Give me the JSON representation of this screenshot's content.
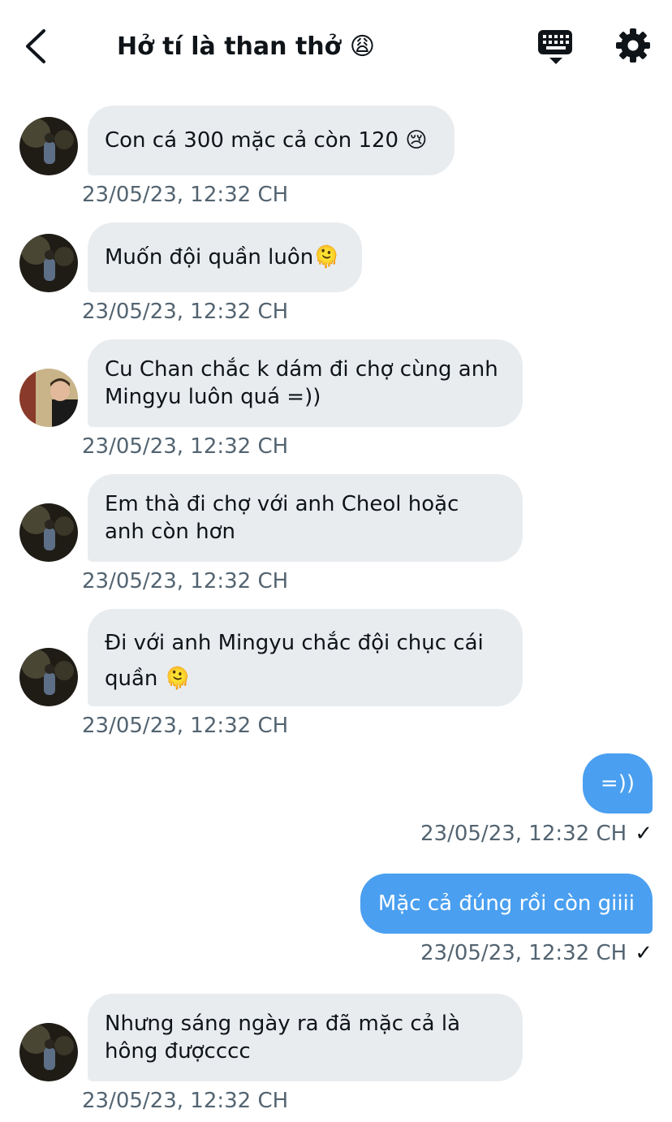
{
  "header": {
    "back_label": "",
    "title": "Hở tí là than thở 😩"
  },
  "messages": [
    {
      "text": "Con cá 300 mặc cả còn 120 😢",
      "time": "23/05/23, 12:32 CH"
    },
    {
      "text": "Muốn đội quần luôn🫠",
      "time": "23/05/23, 12:32 CH"
    },
    {
      "text": "Cu Chan chắc k dám đi chợ cùng anh Mingyu luôn quá =))",
      "time": "23/05/23, 12:32 CH"
    },
    {
      "text": "Em thà đi chợ với anh Cheol hoặc anh còn hơn",
      "time": "23/05/23, 12:32 CH"
    },
    {
      "text": "Đi với anh Mingyu chắc đội chục cái quần 🫠",
      "time": "23/05/23, 12:32 CH"
    },
    {
      "text": "=))",
      "time": "23/05/23, 12:32 CH"
    },
    {
      "text": "Mặc cả đúng rồi còn giiii",
      "time": "23/05/23, 12:32 CH"
    },
    {
      "text": "Nhưng sáng ngày ra đã mặc cả là hông đượcccc",
      "time": "23/05/23, 12:32 CH"
    }
  ],
  "icons": {
    "back": "chevron-left-icon",
    "keyboard": "keyboard-icon",
    "settings": "gear-icon",
    "read": "checkmark-icon"
  },
  "colors": {
    "outgoing_bubble": "#4a9ff0",
    "incoming_bubble": "#e9ecef",
    "timestamp": "#536471"
  }
}
